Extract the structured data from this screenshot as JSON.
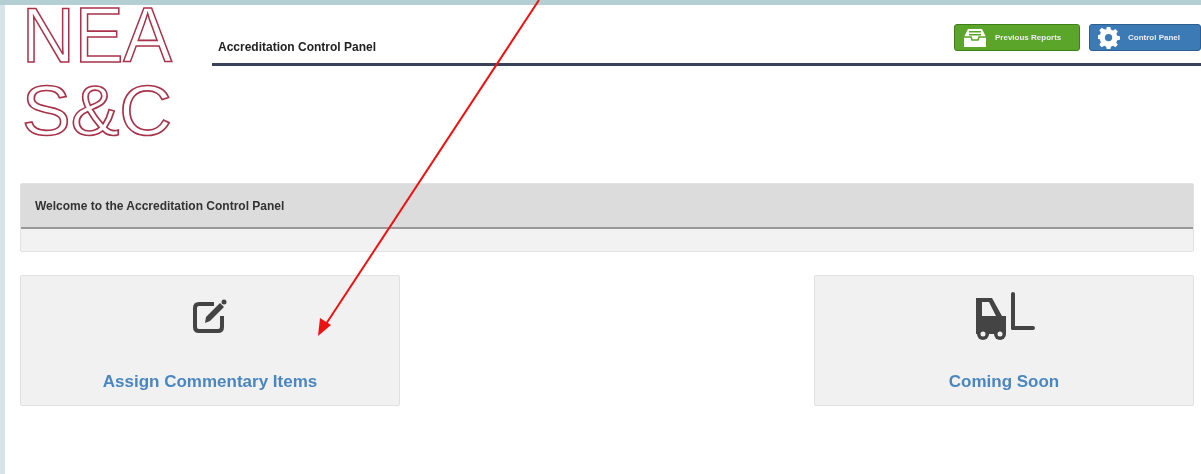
{
  "logo": {
    "lines": [
      "NEA",
      "S&C"
    ]
  },
  "header": {
    "title": "Accreditation Control Panel"
  },
  "buttons": [
    {
      "label": "Previous Reports",
      "kind": "inbox"
    },
    {
      "label": "Control Panel",
      "kind": "gear"
    }
  ],
  "welcome": {
    "title": "Welcome to the Accreditation Control Panel"
  },
  "tiles": [
    {
      "label": "Assign Commentary Items",
      "kind": "edit"
    },
    {
      "label": "Coming Soon",
      "kind": "forklift"
    }
  ]
}
